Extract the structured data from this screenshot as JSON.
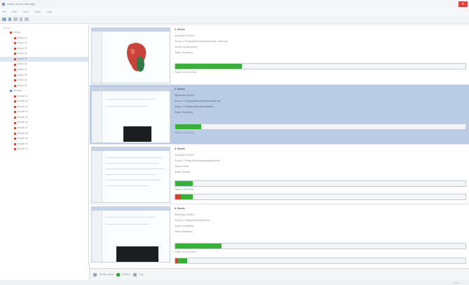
{
  "window": {
    "title": "Virtual Studio Manager",
    "close_glyph": "✕"
  },
  "menu": [
    "File",
    "Edit",
    "View",
    "Tools",
    "Help"
  ],
  "toolbar_icons": [
    "back-icon",
    "forward-icon",
    "refresh-icon",
    "scan-icon",
    "settings-icon"
  ],
  "tree": {
    "header": "Projects",
    "items": [
      {
        "label": "Library",
        "level": "root",
        "icon": "folder-red-icon"
      },
      {
        "label": "Scene 01",
        "level": "child",
        "icon": "file-red-icon"
      },
      {
        "label": "Scene 02",
        "level": "child",
        "icon": "file-red-icon"
      },
      {
        "label": "Scene 03",
        "level": "child",
        "icon": "file-red-icon"
      },
      {
        "label": "Scene 04",
        "level": "child",
        "icon": "file-red-icon"
      },
      {
        "label": "Scene 05",
        "level": "child",
        "icon": "file-red-icon",
        "selected": true
      },
      {
        "label": "Scene 06",
        "level": "child",
        "icon": "file-red-icon"
      },
      {
        "label": "Scene 07",
        "level": "child",
        "icon": "file-red-icon"
      },
      {
        "label": "Scene 08",
        "level": "child",
        "icon": "file-red-icon"
      },
      {
        "label": "Scene 09",
        "level": "child",
        "icon": "file-red-icon"
      },
      {
        "label": "Scene 10",
        "level": "child",
        "icon": "file-red-icon"
      },
      {
        "label": "Renders",
        "level": "root",
        "icon": "folder-blue-icon"
      },
      {
        "label": "Render 01",
        "level": "child",
        "icon": "file-red-icon"
      },
      {
        "label": "Render 02",
        "level": "child",
        "icon": "file-red-icon"
      },
      {
        "label": "Render 03",
        "level": "child",
        "icon": "file-red-icon"
      },
      {
        "label": "Render 04",
        "level": "child",
        "icon": "file-red-icon"
      },
      {
        "label": "Render 05",
        "level": "child",
        "icon": "file-red-icon"
      },
      {
        "label": "Render 06",
        "level": "child",
        "icon": "file-red-icon"
      },
      {
        "label": "Render 07",
        "level": "child",
        "icon": "file-red-icon"
      },
      {
        "label": "Render 08",
        "level": "child",
        "icon": "file-red-icon"
      },
      {
        "label": "Render 09",
        "level": "child",
        "icon": "file-red-icon"
      },
      {
        "label": "Render 10",
        "level": "child",
        "icon": "file-red-icon"
      },
      {
        "label": "Render 11",
        "level": "child",
        "icon": "file-red-icon"
      }
    ]
  },
  "cards": [
    {
      "title": "1. Scene",
      "lines": [
        "Start frame: 000001",
        "Source: C:\\Projects\\Scene\\preview\\render_model.vsd",
        "Output: render/preview",
        "Status: Rendering"
      ],
      "progress": 0.23,
      "status": "Frame 14 of 60 (23%)",
      "selected": false
    },
    {
      "title": "2. Scene",
      "lines": [
        "Start frame: 000001",
        "Source: C:\\Projects\\Scene\\preview\\render.vsd",
        "Output: C:\\Projects\\Scene\\preview\\final",
        "Status: Rendering"
      ],
      "progress": 0.09,
      "status": "Frame 5 of 60 (9%)",
      "selected": true
    },
    {
      "title": "3. Scene",
      "lines": [
        "Start frame: 000001",
        "Source: C:\\Projects\\Scene\\preview\\layout.vsd",
        "Output: render",
        "Status: Queued"
      ],
      "progress": 0.06,
      "status": "Frame 3 of 60 (6%)",
      "progress2": {
        "red": 0.02,
        "green": 0.04
      },
      "selected": false
    },
    {
      "title": "4. Scene",
      "lines": [
        "Start frame: 000001",
        "Source: C:\\Projects\\Scene\\final.vsd",
        "Output: render/final",
        "Status: Rendering"
      ],
      "progress": 0.16,
      "status": "Frame 10 of 60 (16%)",
      "progress2": {
        "red": 0.01,
        "green": 0.03
      },
      "selected": false
    }
  ],
  "statusbar": {
    "items": [
      {
        "icon": "queue-icon",
        "text": "Render queue"
      },
      {
        "icon": "monitor-icon",
        "text": "Monitor"
      },
      {
        "icon": "log-icon",
        "text": "Log"
      }
    ]
  },
  "footer": {
    "text": "4 jobs"
  },
  "colors": {
    "selection": "#b9cbe6",
    "progress": "#35b235",
    "error": "#d9402f",
    "close": "#d9473c"
  }
}
